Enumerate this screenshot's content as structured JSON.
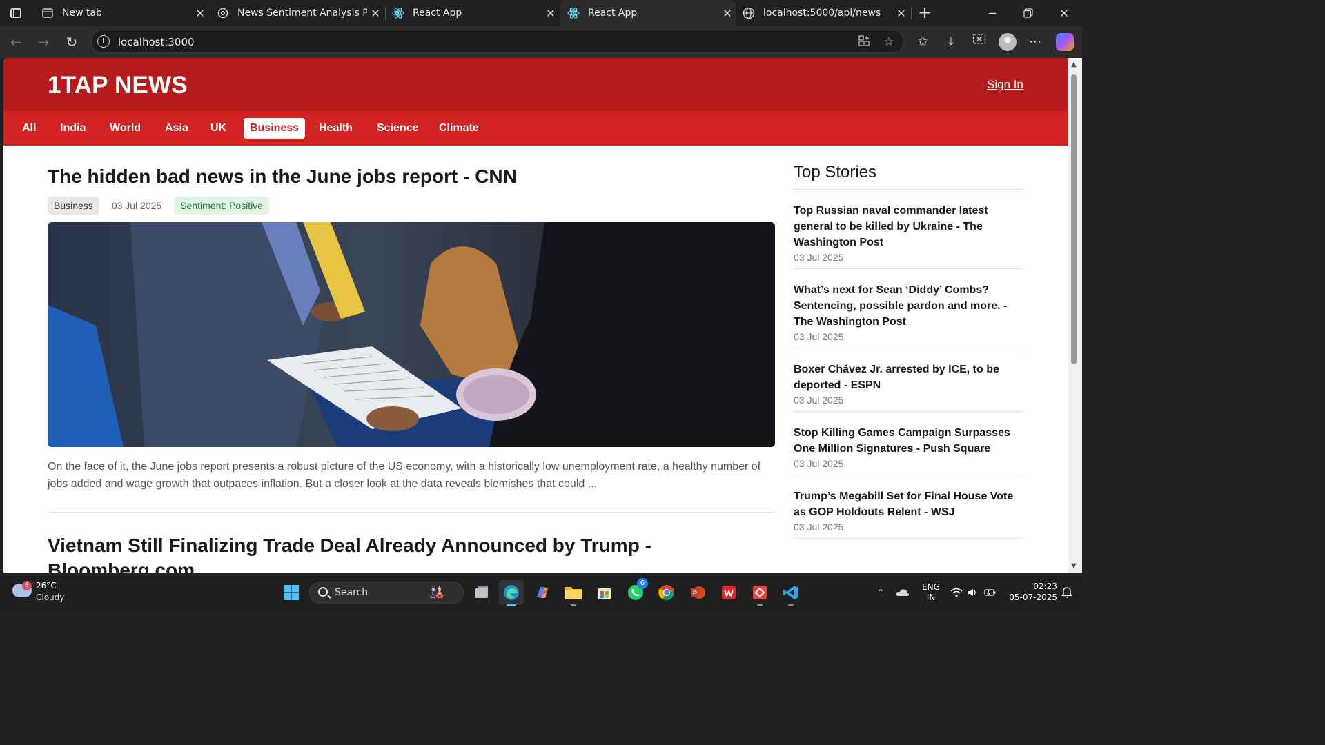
{
  "browser": {
    "tabs": [
      {
        "title": "New tab",
        "icon": "newtab-icon",
        "active": false
      },
      {
        "title": "News Sentiment Analysis Page",
        "icon": "chatgpt-icon",
        "active": false
      },
      {
        "title": "React App",
        "icon": "react-icon",
        "active": false
      },
      {
        "title": "React App",
        "icon": "react-icon",
        "active": true
      },
      {
        "title": "localhost:5000/api/news",
        "icon": "globe-icon",
        "active": false
      }
    ],
    "address": "localhost:3000"
  },
  "site": {
    "brand": "1TAP NEWS",
    "sign_in": "Sign In",
    "categories": [
      "All",
      "India",
      "World",
      "Asia",
      "UK",
      "Business",
      "Health",
      "Science",
      "Climate"
    ],
    "active_category": "Business",
    "colors": {
      "header": "#b71c1c",
      "nav": "#d32222",
      "positive": "#1f7a34"
    }
  },
  "article": {
    "title": "The hidden bad news in the June jobs report - CNN",
    "category": "Business",
    "date": "03 Jul 2025",
    "sentiment": "Sentiment: Positive",
    "description": "On the face of it, the June jobs report presents a robust picture of the US economy, with a historically low unemployment rate, a healthy number of jobs added and wage growth that outpaces inflation. But a closer look at the data reveals blemishes that could ..."
  },
  "article2": {
    "title": "Vietnam Still Finalizing Trade Deal Already Announced by Trump - Bloomberg.com"
  },
  "sidebar": {
    "heading": "Top Stories",
    "stories": [
      {
        "title": "Top Russian naval commander latest general to be killed by Ukraine - The Washington Post",
        "date": "03 Jul 2025"
      },
      {
        "title": "What’s next for Sean ‘Diddy’ Combs? Sentencing, possible pardon and more. - The Washington Post",
        "date": "03 Jul 2025"
      },
      {
        "title": "Boxer Chávez Jr. arrested by ICE, to be deported - ESPN",
        "date": "03 Jul 2025"
      },
      {
        "title": "Stop Killing Games Campaign Surpasses One Million Signatures - Push Square",
        "date": "03 Jul 2025"
      },
      {
        "title": "Trump’s Megabill Set for Final House Vote as GOP Holdouts Relent - WSJ",
        "date": "03 Jul 2025"
      }
    ]
  },
  "taskbar": {
    "weather": {
      "temp": "26°C",
      "condition": "Cloudy",
      "badge": "8"
    },
    "search_label": "Search",
    "whatsapp_badge": "6",
    "language": "ENG",
    "region": "IN",
    "time": "02:23",
    "date": "05-07-2025"
  }
}
